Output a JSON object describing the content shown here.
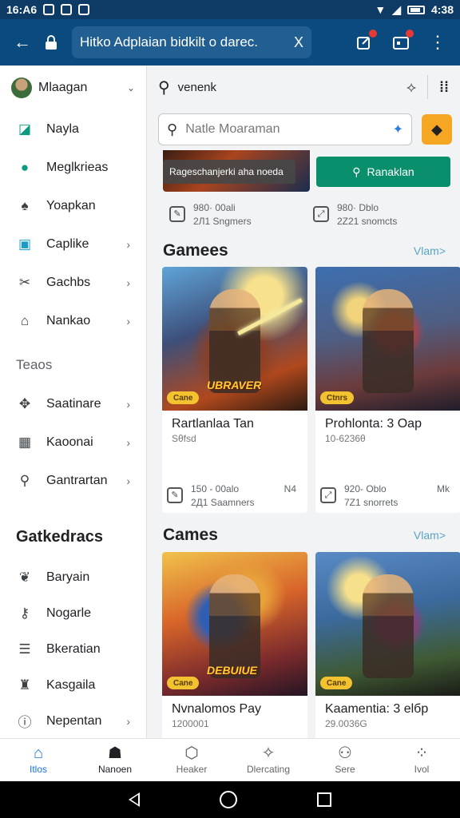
{
  "status_bar": {
    "time": "16:A6",
    "battery_time": "4:38"
  },
  "app_bar": {
    "url_text": "Hitko Adplaian bidkilt o darec.",
    "clear_glyph": "X"
  },
  "drawer": {
    "account_name": "Mlaagan",
    "items_top": [
      {
        "label": "Nayla",
        "icon": "square-icon"
      },
      {
        "label": "Meglkrieas",
        "icon": "chat-icon"
      },
      {
        "label": "Yoapkan",
        "icon": "bell-icon"
      },
      {
        "label": "Caplike",
        "icon": "briefcase-icon"
      },
      {
        "label": "Gachbs",
        "icon": "ticket-icon"
      },
      {
        "label": "Nankao",
        "icon": "building-icon"
      }
    ],
    "section1": "Teaos",
    "items_mid": [
      {
        "label": "Saatinare",
        "icon": "wrench-icon"
      },
      {
        "label": "Kaoonai",
        "icon": "calendar-icon"
      },
      {
        "label": "Gantrartan",
        "icon": "search-icon"
      }
    ],
    "section2": "Gatkedracs",
    "items_bottom": [
      {
        "label": "Baryain",
        "icon": "leaf-icon"
      },
      {
        "label": "Nogarle",
        "icon": "key-icon"
      },
      {
        "label": "Bkeratian",
        "icon": "list-icon"
      },
      {
        "label": "Kasgaila",
        "icon": "bag-icon"
      },
      {
        "label": "Nepentan",
        "icon": "info-icon"
      }
    ]
  },
  "main": {
    "search_query": "venenk",
    "input_placeholder": "Natle Moaraman",
    "tooltip": "Rageschanjerki aha noeda",
    "green_button": "Ranaklan",
    "top_cards": [
      {
        "line1": "980· 00ali",
        "line2": "2Л1 Sngmers"
      },
      {
        "line1": "980· Dblo",
        "line2": "2Z21 snomcts"
      }
    ],
    "section_a": {
      "title": "Gamees",
      "more": "Vlam>"
    },
    "section_b": {
      "title": "Cames",
      "more": "Vlam>"
    },
    "games_a": [
      {
        "title": "Rartlanlaa Tan",
        "sub": "Sθfsd",
        "pill": "Cane",
        "banner": "UBRAVER",
        "line1": "150 - 00alo",
        "line2": "2Д1 Saamners",
        "tag": "N4"
      },
      {
        "title": "Prohlonta: 3 Oap",
        "sub": "10-6236θ",
        "pill": "Ctnrs",
        "banner": "",
        "line1": "920- Oblo",
        "line2": "7Z1 snorrets",
        "tag": "Mk"
      }
    ],
    "games_b": [
      {
        "title": "Nvnalomos Pay",
        "sub": "1200001",
        "pill": "Cane",
        "banner": "DEBUIUE"
      },
      {
        "title": "Kaamentia: 3 elбp",
        "sub": "29.0036G",
        "pill": "Cane",
        "banner": ""
      }
    ]
  },
  "bottom_nav": [
    {
      "label": "Itlos",
      "icon": "home-icon"
    },
    {
      "label": "Nanoen",
      "icon": "house-icon"
    },
    {
      "label": "Heaker",
      "icon": "hexagon-icon"
    },
    {
      "label": "Dlercating",
      "icon": "badge-icon"
    },
    {
      "label": "Sere",
      "icon": "people-icon"
    },
    {
      "label": "Ivol",
      "icon": "dots-icon"
    }
  ]
}
